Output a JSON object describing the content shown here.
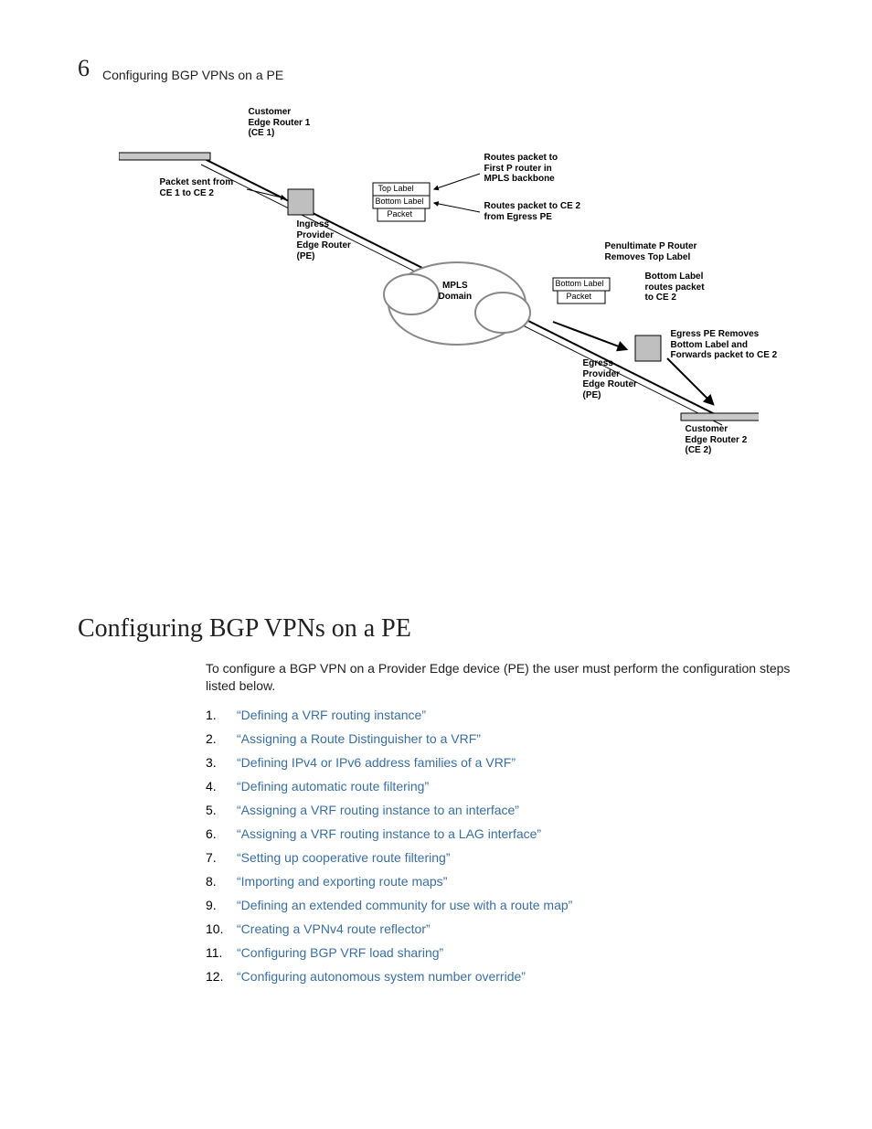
{
  "chapter_number": "6",
  "running_title": "Configuring BGP VPNs on a PE",
  "figure": {
    "ce1": "Customer\nEdge Router 1\n(CE 1)",
    "packet_sent": "Packet sent from\nCE 1 to CE 2",
    "ingress_pe": "Ingress\nProvider\nEdge Router\n(PE)",
    "top_label": "Top Label",
    "bottom_label": "Bottom Label",
    "packet": "Packet",
    "routes_first_p": "Routes packet to\nFirst P router in\nMPLS backbone",
    "routes_ce2_egress": "Routes packet to CE 2\nfrom Egress PE",
    "mpls_domain": "MPLS\nDomain",
    "penultimate": "Penultimate P Router\nRemoves Top Label",
    "bottom_routes_ce2": "Bottom Label\nroutes packet\nto CE 2",
    "egress_pe": "Egress\nProvider\nEdge Router\n(PE)",
    "egress_removes": "Egress PE Removes\nBottom Label and\nForwards packet to CE 2",
    "ce2": "Customer\nEdge Router 2\n(CE 2)"
  },
  "section_heading": "Configuring BGP VPNs on a PE",
  "intro": "To configure a BGP VPN on a Provider Edge device (PE) the user must perform the configuration steps listed below.",
  "steps": [
    "Defining a VRF routing instance",
    "Assigning a Route Distinguisher to a VRF",
    "Defining IPv4 or IPv6 address families of a VRF",
    "Defining automatic route filtering",
    "Assigning a VRF routing instance to an interface",
    "Assigning a VRF routing instance to a LAG interface",
    "Setting up cooperative route filtering",
    "Importing and exporting route maps",
    "Defining an extended community for use with a route map",
    "Creating a VPNv4 route reflector",
    "Configuring BGP VRF load sharing",
    "Configuring autonomous system number override"
  ]
}
